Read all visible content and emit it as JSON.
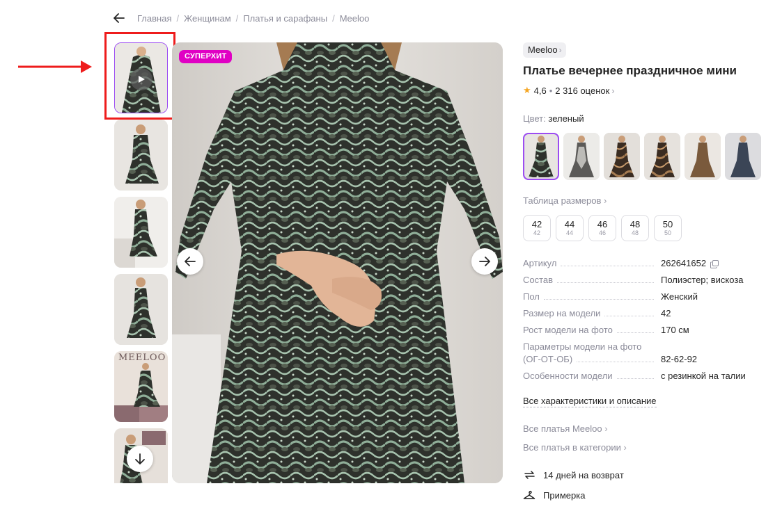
{
  "breadcrumb": {
    "items": [
      "Главная",
      "Женщинам",
      "Платья и сарафаны",
      "Meeloo"
    ],
    "separator": "/"
  },
  "gallery": {
    "badge": "СУПЕРХИТ",
    "thumbnail_count": 6,
    "selected_thumbnail": 1,
    "thumb_brand_text": "MEELOO"
  },
  "product": {
    "brand": "Meeloo",
    "title": "Платье вечернее праздничное мини",
    "rating": "4,6",
    "reviews": "2 316 оценок",
    "color_label": "Цвет:",
    "color_value": "зеленый",
    "size_table_link": "Таблица размеров",
    "sizes": [
      {
        "main": "42",
        "sub": "42"
      },
      {
        "main": "44",
        "sub": "44"
      },
      {
        "main": "46",
        "sub": "46"
      },
      {
        "main": "48",
        "sub": "48"
      },
      {
        "main": "50",
        "sub": "50"
      }
    ]
  },
  "specs": [
    {
      "key": "Артикул",
      "value": "262641652"
    },
    {
      "key": "Состав",
      "value": "Полиэстер; вискоза"
    },
    {
      "key": "Пол",
      "value": "Женский"
    },
    {
      "key": "Размер на модели",
      "value": "42"
    },
    {
      "key": "Рост модели на фото",
      "value": "170 см"
    },
    {
      "key_line1": "Параметры модели на фото",
      "key_line2": "(ОГ-ОТ-ОБ)",
      "value": "82-62-92"
    },
    {
      "key": "Особенности модели",
      "value": "с резинкой на талии"
    }
  ],
  "links": {
    "all_specs": "Все характеристики и описание",
    "all_brand": "Все платья Meeloo",
    "all_category": "Все платья в категории"
  },
  "features": {
    "return": "14 дней на возврат",
    "fitting": "Примерка"
  },
  "colors": {
    "accent": "#9c4cf2",
    "badge": "#e000c4",
    "annotation": "#ee1c1c",
    "star": "#f5a623"
  }
}
